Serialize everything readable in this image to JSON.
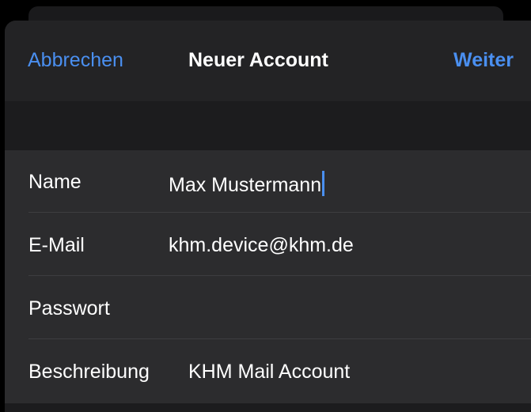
{
  "navbar": {
    "cancel_label": "Abbrechen",
    "title": "Neuer Account",
    "next_label": "Weiter"
  },
  "form": {
    "fields": [
      {
        "label": "Name",
        "value": "Max Mustermann"
      },
      {
        "label": "E-Mail",
        "value": "khm.device@khm.de"
      },
      {
        "label": "Passwort",
        "value": ""
      },
      {
        "label": "Beschreibung",
        "value": "KHM Mail Account"
      }
    ]
  },
  "colors": {
    "accent": "#4a8ff0",
    "background": "#000000",
    "sheet": "#1c1c1e",
    "row": "#2c2c2e"
  }
}
